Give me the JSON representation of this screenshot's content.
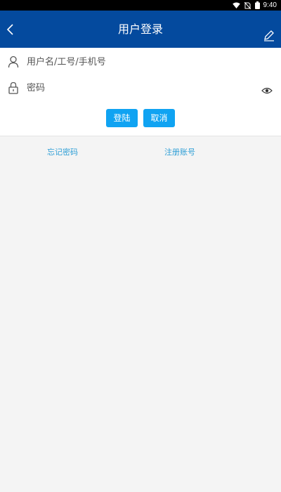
{
  "status_bar": {
    "time": "9:40",
    "icons": [
      "wifi-icon",
      "no-sim-icon",
      "battery-icon"
    ]
  },
  "header": {
    "title": "用户登录",
    "background_color": "#044a9e"
  },
  "form": {
    "username": {
      "placeholder": "用户名/工号/手机号",
      "value": ""
    },
    "password": {
      "placeholder": "密码",
      "value": ""
    },
    "login_label": "登陆",
    "cancel_label": "取消",
    "button_color": "#10a3f2"
  },
  "links": {
    "forgot_password": "忘记密码",
    "register": "注册账号",
    "link_color": "#2f9fd6"
  }
}
